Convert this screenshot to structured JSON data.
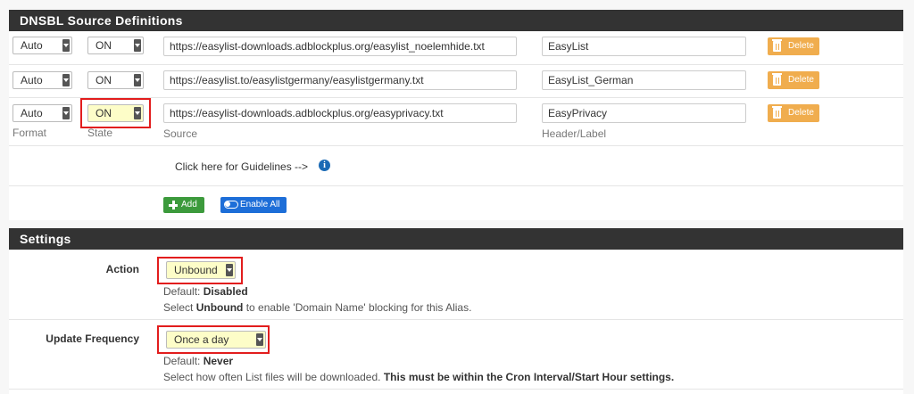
{
  "dnsbl": {
    "title": "DNSBL Source Definitions",
    "rows": [
      {
        "format": "Auto",
        "state": "ON",
        "source": "https://easylist-downloads.adblockplus.org/easylist_noelemhide.txt",
        "label": "EasyList",
        "delete": "Delete"
      },
      {
        "format": "Auto",
        "state": "ON",
        "source": "https://easylist.to/easylistgermany/easylistgermany.txt",
        "label": "EasyList_German",
        "delete": "Delete"
      },
      {
        "format": "Auto",
        "state": "ON",
        "source": "https://easylist-downloads.adblockplus.org/easyprivacy.txt",
        "label": "EasyPrivacy",
        "delete": "Delete"
      }
    ],
    "captions": {
      "format": "Format",
      "state": "State",
      "source": "Source",
      "label": "Header/Label"
    },
    "guidelines": "Click here for Guidelines -->",
    "add_label": "Add",
    "enable_all_label": "Enable All"
  },
  "settings": {
    "title": "Settings",
    "action": {
      "label": "Action",
      "value": "Unbound",
      "default_prefix": "Default:",
      "default_value": "Disabled",
      "help_pre": "Select",
      "help_bold": "Unbound",
      "help_post": "to enable 'Domain Name' blocking for this Alias."
    },
    "update_frequency": {
      "label": "Update Frequency",
      "value": "Once a day",
      "default_prefix": "Default:",
      "default_value": "Never",
      "help_pre": "Select how often List files will be downloaded.",
      "help_bold": "This must be within the Cron Interval/Start Hour settings."
    }
  },
  "colors": {
    "header_bg": "#333333",
    "delete": "#f0ad4e",
    "add": "#3c9a3c",
    "enable": "#1d6ed8",
    "highlight": "#e21d1d"
  }
}
